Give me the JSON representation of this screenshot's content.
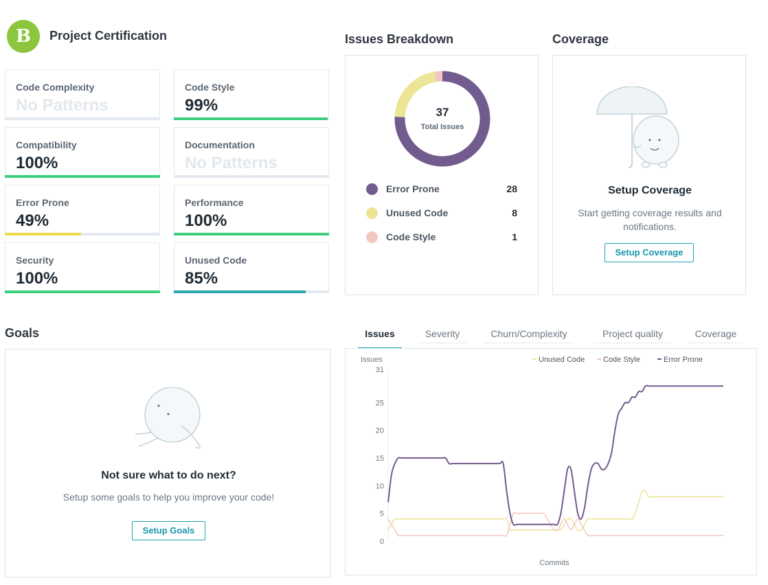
{
  "header": {
    "grade": "B",
    "title": "Project Certification"
  },
  "colors": {
    "green": "#3ecf7e",
    "yellow": "#ecd94a",
    "teal": "#2aa7b0",
    "track": "#e3e9ee",
    "error_prone": "#725b8e",
    "unused_code": "#ebe595",
    "code_style": "#f4c6c2"
  },
  "metrics": [
    {
      "label": "Code Complexity",
      "value": "No Patterns",
      "muted": true,
      "fill": 0,
      "color": "#e3e9ee"
    },
    {
      "label": "Code Style",
      "value": "99%",
      "muted": false,
      "fill": 0.99,
      "color": "#3ecf7e"
    },
    {
      "label": "Compatibility",
      "value": "100%",
      "muted": false,
      "fill": 1.0,
      "color": "#3ecf7e"
    },
    {
      "label": "Documentation",
      "value": "No Patterns",
      "muted": true,
      "fill": 0,
      "color": "#e3e9ee"
    },
    {
      "label": "Error Prone",
      "value": "49%",
      "muted": false,
      "fill": 0.49,
      "color": "#ecd94a"
    },
    {
      "label": "Performance",
      "value": "100%",
      "muted": false,
      "fill": 1.0,
      "color": "#3ecf7e"
    },
    {
      "label": "Security",
      "value": "100%",
      "muted": false,
      "fill": 1.0,
      "color": "#3ecf7e"
    },
    {
      "label": "Unused Code",
      "value": "85%",
      "muted": false,
      "fill": 0.85,
      "color": "#2aa7b0"
    }
  ],
  "issues_breakdown": {
    "title": "Issues Breakdown",
    "total": "37",
    "total_label": "Total Issues",
    "items": [
      {
        "name": "Error Prone",
        "count": "28",
        "color": "#725b8e"
      },
      {
        "name": "Unused Code",
        "count": "8",
        "color": "#ebe595"
      },
      {
        "name": "Code Style",
        "count": "1",
        "color": "#f4c6c2"
      }
    ]
  },
  "coverage": {
    "title": "Coverage",
    "heading": "Setup Coverage",
    "text_line1": "Start getting coverage results and",
    "text_line2": "notifications.",
    "button": "Setup Coverage"
  },
  "goals": {
    "title": "Goals",
    "heading": "Not sure what to do next?",
    "text": "Setup some goals to help you improve your code!",
    "button": "Setup Goals"
  },
  "tabs": [
    {
      "label": "Issues",
      "active": true
    },
    {
      "label": "Severity",
      "active": false
    },
    {
      "label": "Churn/Complexity",
      "active": false
    },
    {
      "label": "Project quality",
      "active": false
    },
    {
      "label": "Coverage",
      "active": false
    }
  ],
  "chart_data": {
    "type": "line",
    "ylabel": "Issues",
    "xlabel": "Commits",
    "ylim": [
      0,
      31
    ],
    "yticks": [
      0,
      5,
      10,
      15,
      20,
      25,
      31
    ],
    "legend_position": "top-right",
    "grid": false,
    "x": [
      1,
      2,
      3,
      4,
      5,
      6,
      7,
      8,
      9,
      10,
      11,
      12,
      13,
      14,
      15,
      16,
      17,
      18,
      19,
      20,
      21,
      22,
      23,
      24,
      25,
      26,
      27,
      28,
      29,
      30,
      31,
      32,
      33,
      34,
      35,
      36,
      37,
      38,
      39,
      40,
      41,
      42,
      43,
      44,
      45,
      46,
      47,
      48,
      49,
      50,
      51,
      52,
      53,
      54,
      55,
      56,
      57,
      58,
      59,
      60,
      61,
      62,
      63,
      64,
      65,
      66,
      67,
      68,
      69,
      70,
      71,
      72,
      73,
      74,
      75,
      76,
      77,
      78,
      79,
      80,
      81,
      82,
      83,
      84,
      85,
      86,
      87,
      88,
      89,
      90,
      91,
      92,
      93,
      94,
      95,
      96,
      97,
      98,
      99,
      100
    ],
    "series": [
      {
        "name": "Unused Code",
        "color": "#ebe595",
        "values": [
          2,
          3,
          4,
          4,
          4,
          4,
          4,
          4,
          4,
          4,
          4,
          4,
          4,
          4,
          4,
          4,
          4,
          4,
          4,
          4,
          4,
          4,
          4,
          4,
          4,
          4,
          4,
          4,
          4,
          4,
          4,
          4,
          4,
          4,
          4,
          4,
          2,
          2,
          2,
          2,
          2,
          2,
          2,
          2,
          2,
          2,
          2,
          2,
          2,
          2,
          2,
          2,
          3,
          4,
          4,
          3,
          2,
          2,
          3,
          4,
          4,
          4,
          4,
          4,
          4,
          4,
          4,
          4,
          4,
          4,
          4,
          4,
          4,
          5,
          7,
          9,
          9,
          8,
          8,
          8,
          8,
          8,
          8,
          8,
          8,
          8,
          8,
          8,
          8,
          8,
          8,
          8,
          8,
          8,
          8,
          8,
          8,
          8,
          8,
          8
        ]
      },
      {
        "name": "Code Style",
        "color": "#f4c6c2",
        "values": [
          4,
          3,
          2,
          1,
          1,
          1,
          1,
          1,
          1,
          1,
          1,
          1,
          1,
          1,
          1,
          1,
          1,
          1,
          1,
          1,
          1,
          1,
          1,
          1,
          1,
          1,
          1,
          1,
          1,
          1,
          1,
          1,
          1,
          1,
          1,
          1,
          3,
          5,
          5,
          5,
          5,
          5,
          5,
          5,
          5,
          5,
          5,
          4,
          3,
          2,
          2,
          3,
          4,
          3,
          2,
          3,
          4,
          3,
          2,
          1,
          1,
          1,
          1,
          1,
          1,
          1,
          1,
          1,
          1,
          1,
          1,
          1,
          1,
          1,
          1,
          1,
          1,
          1,
          1,
          1,
          1,
          1,
          1,
          1,
          1,
          1,
          1,
          1,
          1,
          1,
          1,
          1,
          1,
          1,
          1,
          1,
          1,
          1,
          1,
          1
        ]
      },
      {
        "name": "Error Prone",
        "color": "#725b8e",
        "values": [
          7,
          12,
          14,
          15,
          15,
          15,
          15,
          15,
          15,
          15,
          15,
          15,
          15,
          15,
          15,
          15,
          15,
          15,
          14,
          14,
          14,
          14,
          14,
          14,
          14,
          14,
          14,
          14,
          14,
          14,
          14,
          14,
          14,
          14,
          14,
          9,
          5,
          3,
          3,
          3,
          3,
          3,
          3,
          3,
          3,
          3,
          3,
          3,
          3,
          3,
          3,
          5,
          9,
          13,
          13,
          9,
          5,
          4,
          6,
          10,
          13,
          14,
          14,
          13,
          13,
          14,
          16,
          20,
          23,
          24,
          25,
          25,
          26,
          26,
          27,
          27,
          28,
          28,
          28,
          28,
          28,
          28,
          28,
          28,
          28,
          28,
          28,
          28,
          28,
          28,
          28,
          28,
          28,
          28,
          28,
          28,
          28,
          28,
          28,
          28
        ]
      }
    ]
  }
}
